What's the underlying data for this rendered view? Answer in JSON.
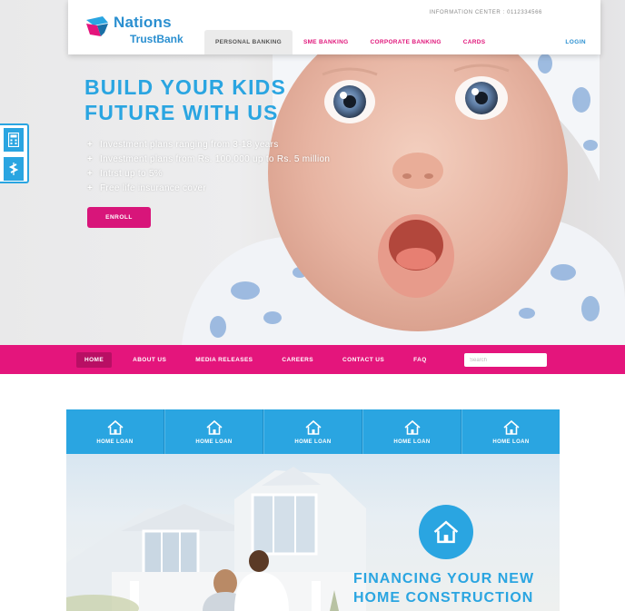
{
  "brand": {
    "name_line1": "Nations",
    "name_line2": "TrustBank",
    "accent": "#2aa5e1",
    "pink": "#e4157c"
  },
  "header": {
    "info_center": "INFORMATION CENTER : 0112334566",
    "nav": [
      {
        "label": "PERSONAL BANKING",
        "active": true
      },
      {
        "label": "SME BANKING",
        "active": false
      },
      {
        "label": "CORPORATE BANKING",
        "active": false
      },
      {
        "label": "CARDS",
        "active": false
      }
    ],
    "login": "LOGIN"
  },
  "side_widget": {
    "icons": [
      "calculator-icon",
      "currency-icon"
    ]
  },
  "hero": {
    "headline_line1": "BUILD YOUR KIDS",
    "headline_line2": "FUTURE WITH US",
    "bullets": [
      "Investment plans ranging from 3-18 years",
      "Investment plans from Rs. 100,000 up to Rs. 5 million",
      "Intrst up to 5%",
      "Free life insurance cover"
    ],
    "cta": "ENROLL"
  },
  "main_nav": {
    "items": [
      {
        "label": "HOME",
        "active": true
      },
      {
        "label": "ABOUT US",
        "active": false
      },
      {
        "label": "MEDIA RELEASES",
        "active": false
      },
      {
        "label": "CAREERS",
        "active": false
      },
      {
        "label": "CONTACT US",
        "active": false
      },
      {
        "label": "FAQ",
        "active": false
      }
    ],
    "search_placeholder": "Search"
  },
  "loan_tabs": [
    {
      "label": "HOME LOAN",
      "icon": "house-icon"
    },
    {
      "label": "HOME LOAN",
      "icon": "house-icon"
    },
    {
      "label": "HOME LOAN",
      "icon": "house-icon"
    },
    {
      "label": "HOME LOAN",
      "icon": "house-icon"
    },
    {
      "label": "HOME LOAN",
      "icon": "house-icon"
    }
  ],
  "banner": {
    "title_line1": "FINANCING YOUR NEW",
    "title_line2": "HOME CONSTRUCTION",
    "icon": "house-icon"
  }
}
